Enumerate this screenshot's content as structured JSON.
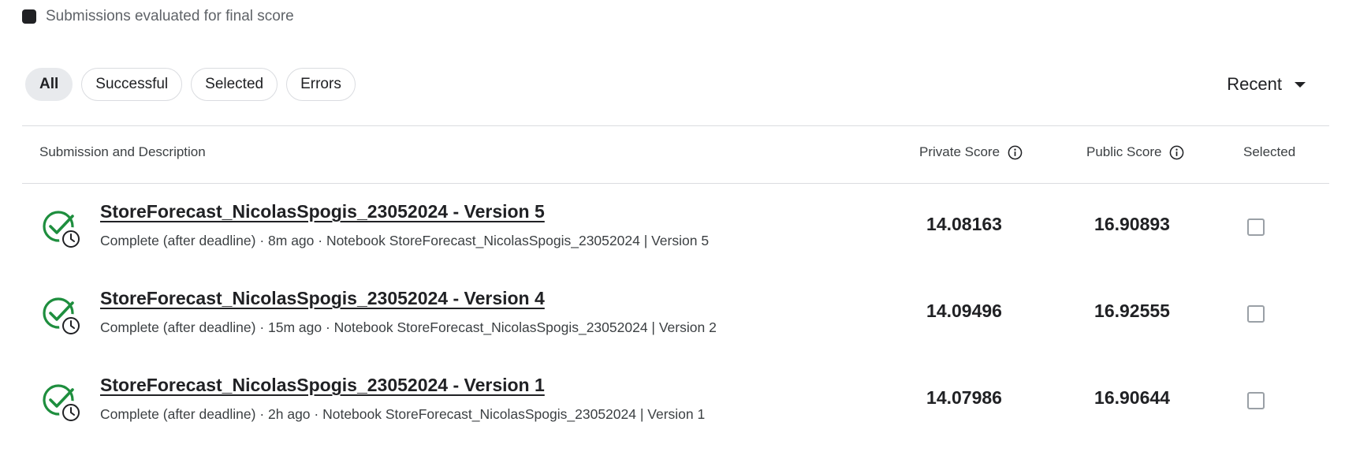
{
  "legend": {
    "text": "Submissions evaluated for final score"
  },
  "filters": [
    {
      "label": "All",
      "active": true
    },
    {
      "label": "Successful",
      "active": false
    },
    {
      "label": "Selected",
      "active": false
    },
    {
      "label": "Errors",
      "active": false
    }
  ],
  "sort": {
    "label": "Recent"
  },
  "table": {
    "headers": {
      "submission": "Submission and Description",
      "private": "Private Score",
      "public": "Public Score",
      "selected": "Selected"
    },
    "rows": [
      {
        "title": "StoreForecast_NicolasSpogis_23052024 - Version 5",
        "desc": "Complete (after deadline) · 8m ago · Notebook StoreForecast_NicolasSpogis_23052024 | Version 5",
        "private": "14.08163",
        "public": "16.90893",
        "selected": false
      },
      {
        "title": "StoreForecast_NicolasSpogis_23052024 - Version 4",
        "desc": "Complete (after deadline) · 15m ago · Notebook StoreForecast_NicolasSpogis_23052024 | Version 2",
        "private": "14.09496",
        "public": "16.92555",
        "selected": false
      },
      {
        "title": "StoreForecast_NicolasSpogis_23052024 - Version 1",
        "desc": "Complete (after deadline) · 2h ago · Notebook StoreForecast_NicolasSpogis_23052024 | Version 1",
        "private": "14.07986",
        "public": "16.90644",
        "selected": false
      }
    ]
  },
  "colors": {
    "success": "#1e8e3e",
    "text": "#202124",
    "border": "#dadce0"
  },
  "icons": {
    "status": "check-circle-clock-icon",
    "info": "info-icon",
    "sort": "caret-down-icon"
  }
}
